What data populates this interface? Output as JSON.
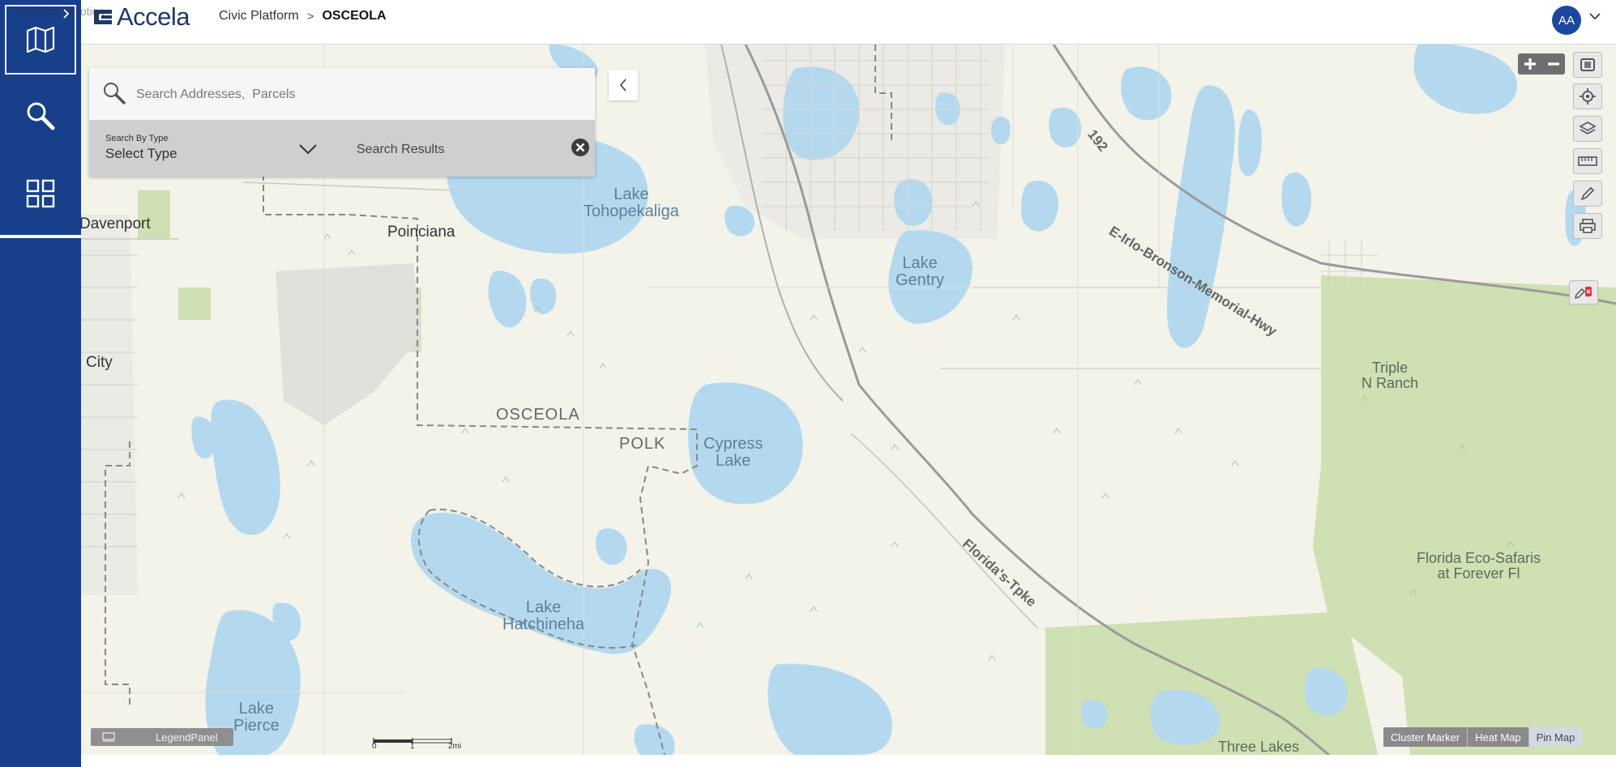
{
  "header": {
    "brand": "Accela",
    "breadcrumb": {
      "root": "Civic Platform",
      "separator": ">",
      "current": "OSCEOLA"
    },
    "user_initials": "AA"
  },
  "sidebar": {
    "ghost_text": "TriClient Inmotion",
    "items": [
      {
        "name": "map",
        "icon": "map-icon"
      },
      {
        "name": "search",
        "icon": "search-icon"
      },
      {
        "name": "apps",
        "icon": "grid-icon"
      }
    ]
  },
  "search": {
    "placeholder": "Search Addresses,  Parcels",
    "type_caption": "Search By Type",
    "type_value": "Select Type",
    "results_label": "Search Results"
  },
  "map": {
    "labels": {
      "davenport": "Davenport",
      "poinciana": "Poinciana",
      "city": "City",
      "tohopekaliga": "Lake\nTohopekaliga",
      "gentry": "Lake\nGentry",
      "hwy_num": "192",
      "hwy": "E-Irlo-Bronson-Memorial-Hwy",
      "osceola": "OSCEOLA",
      "polk": "POLK",
      "cypress": "Cypress\nLake",
      "turnpike": "Florida's-Tpke",
      "hatchineha": "Lake\nHatchineha",
      "pierce": "Lake\nPierce",
      "triple_n": "Triple\nN Ranch",
      "eco_safaris": "Florida Eco-Safaris\nat Forever Fl",
      "three_lakes": "Three Lakes"
    },
    "scale": {
      "zero": "0",
      "one": "1",
      "two": "2mi"
    },
    "legend_label": "LegendPanel",
    "view_modes": [
      "Cluster Marker",
      "Heat Map",
      "Pin Map"
    ],
    "active_view": "Pin Map"
  },
  "colors": {
    "brand": "#173f8a",
    "water": "#b4d9ef",
    "park": "#cfe0b3",
    "land": "#f3f3ea"
  }
}
